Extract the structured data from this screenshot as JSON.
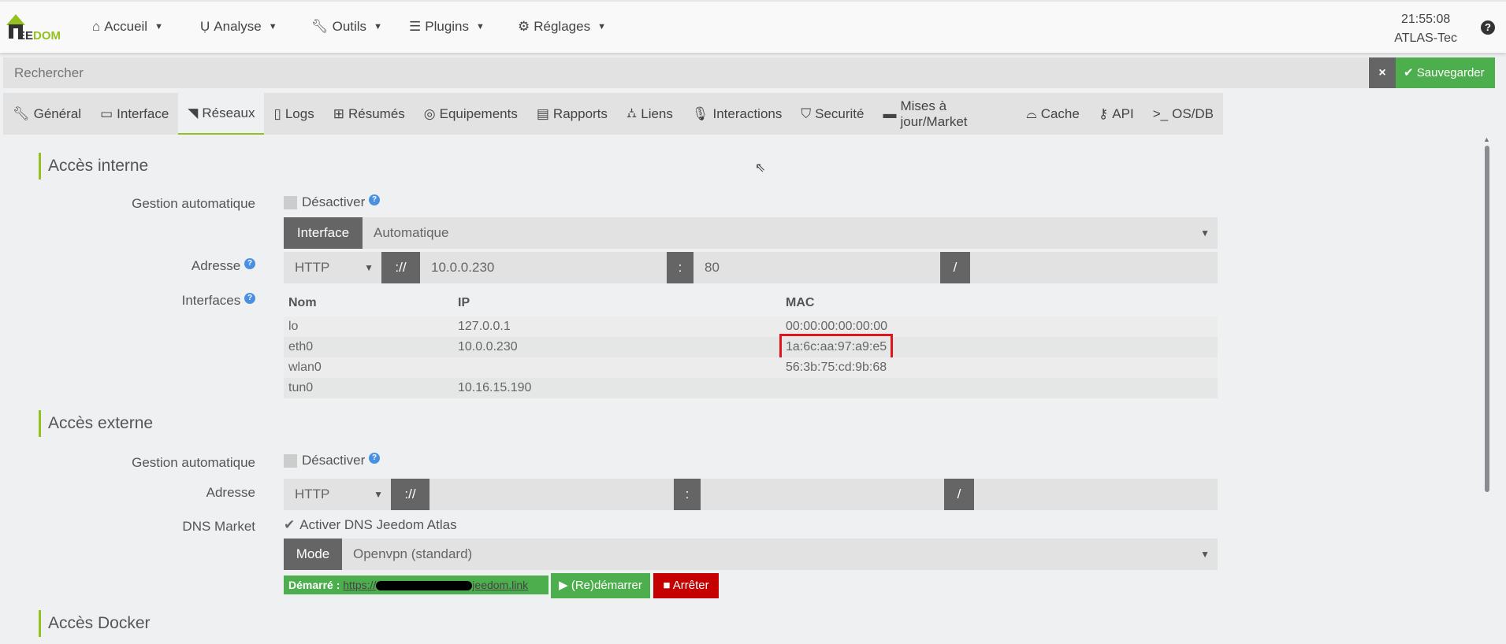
{
  "nav": {
    "logo": "JEEDOM",
    "items": [
      {
        "label": "Accueil",
        "icon": "home-icon"
      },
      {
        "label": "Analyse",
        "icon": "stethoscope-icon"
      },
      {
        "label": "Outils",
        "icon": "wrench-icon"
      },
      {
        "label": "Plugins",
        "icon": "list-icon"
      },
      {
        "label": "Réglages",
        "icon": "cog-icon"
      }
    ],
    "time": "21:55:08",
    "user": "ATLAS-Tec",
    "help": "?"
  },
  "search": {
    "placeholder": "Rechercher"
  },
  "toolbar": {
    "clear": "×",
    "save": "Sauvegarder"
  },
  "tabs": [
    {
      "label": "Général"
    },
    {
      "label": "Interface"
    },
    {
      "label": "Réseaux",
      "active": true
    },
    {
      "label": "Logs"
    },
    {
      "label": "Résumés"
    },
    {
      "label": "Equipements"
    },
    {
      "label": "Rapports"
    },
    {
      "label": "Liens"
    },
    {
      "label": "Interactions"
    },
    {
      "label": "Securité"
    },
    {
      "label": "Mises à jour/Market"
    },
    {
      "label": "Cache"
    },
    {
      "label": "API"
    },
    {
      "label": "OS/DB"
    }
  ],
  "internal": {
    "title": "Accès interne",
    "auto_label": "Gestion automatique",
    "auto_check": "Désactiver",
    "interface_addon": "Interface",
    "interface_value": "Automatique",
    "address_label": "Adresse",
    "protocol": "HTTP",
    "sep1": "://",
    "ip": "10.0.0.230",
    "sep2": ":",
    "port": "80",
    "sep3": "/",
    "interfaces_label": "Interfaces",
    "table": {
      "headers": [
        "Nom",
        "IP",
        "MAC"
      ],
      "rows": [
        [
          "lo",
          "127.0.0.1",
          "00:00:00:00:00:00"
        ],
        [
          "eth0",
          "10.0.0.230",
          "1a:6c:aa:97:a9:e5"
        ],
        [
          "wlan0",
          "",
          "56:3b:75:cd:9b:68"
        ],
        [
          "tun0",
          "10.16.15.190",
          ""
        ]
      ]
    }
  },
  "external": {
    "title": "Accès externe",
    "auto_label": "Gestion automatique",
    "auto_check": "Désactiver",
    "address_label": "Adresse",
    "protocol": "HTTP",
    "sep1": "://",
    "sep2": ":",
    "sep3": "/",
    "dns_label": "DNS Market",
    "dns_check": "Activer DNS Jeedom Atlas",
    "mode_addon": "Mode",
    "mode_value": "Openvpn (standard)",
    "status_label": "Démarré :",
    "status_link_start": "https://",
    "status_link_end": "jeedom.link",
    "restart": "(Re)démarrer",
    "stop": "Arrêter"
  },
  "docker": {
    "title": "Accès Docker"
  }
}
